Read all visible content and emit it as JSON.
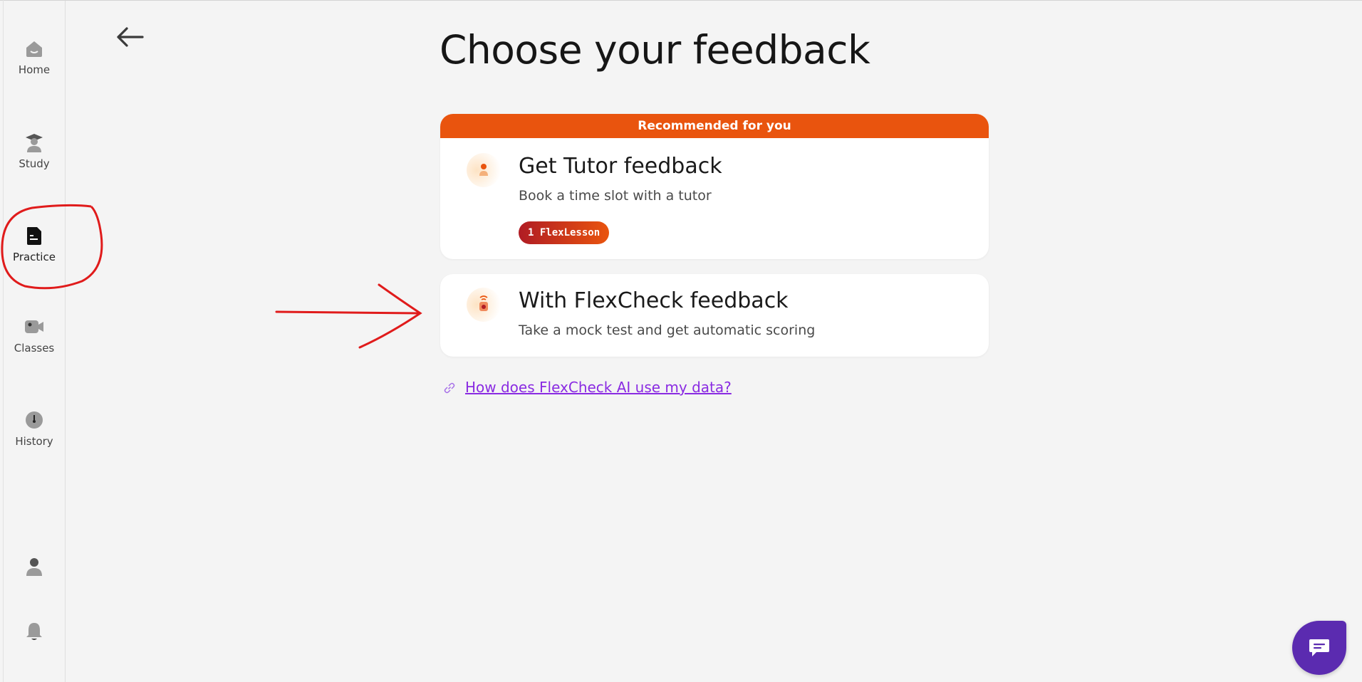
{
  "sidebar": {
    "items": [
      {
        "label": "Home",
        "icon": "home-icon"
      },
      {
        "label": "Study",
        "icon": "graduation-cap-icon"
      },
      {
        "label": "Practice",
        "icon": "document-icon",
        "active": true
      },
      {
        "label": "Classes",
        "icon": "video-camera-icon"
      },
      {
        "label": "History",
        "icon": "clock-icon"
      }
    ],
    "bottom": [
      {
        "icon": "user-icon"
      },
      {
        "icon": "bell-icon"
      }
    ]
  },
  "header": {
    "back_icon": "arrow-left-icon",
    "title": "Choose your feedback"
  },
  "cards": [
    {
      "banner": "Recommended for you",
      "title": "Get Tutor feedback",
      "subtitle": "Book a time slot with a tutor",
      "badge": "1 FlexLesson",
      "icon": "tutor-avatar-icon"
    },
    {
      "title": "With FlexCheck feedback",
      "subtitle": "Take a mock test and get automatic scoring",
      "icon": "robot-avatar-icon"
    }
  ],
  "link": {
    "text": "How does FlexCheck AI use my data?",
    "icon": "link-icon"
  },
  "chat": {
    "icon": "chat-icon"
  },
  "colors": {
    "accent": "#e9540e",
    "badge_start": "#b01c24",
    "link": "#8a2be2",
    "chat": "#5b2bb0",
    "annotation": "#e01b1b",
    "background": "#f4f4f4"
  }
}
